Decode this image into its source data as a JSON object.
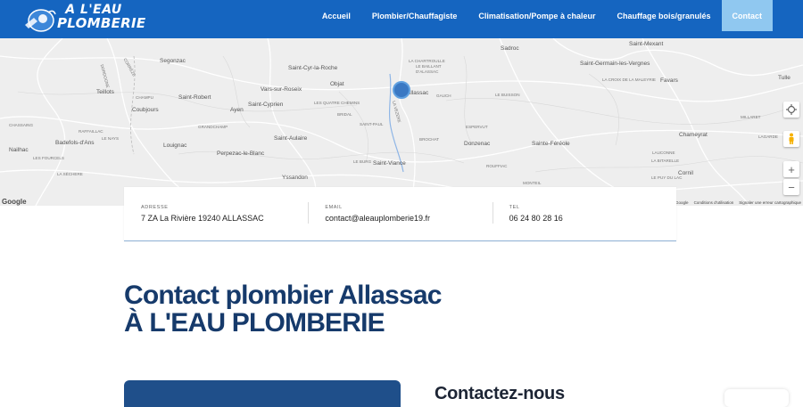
{
  "header": {
    "logo_line1": "A L'EAU",
    "logo_line2": "PLOMBERIE",
    "nav": [
      {
        "label": "Accueil"
      },
      {
        "label": "Plombier/Chauffagiste"
      },
      {
        "label": "Climatisation/Pompe à chaleur"
      },
      {
        "label": "Chauffage bois/granulés"
      },
      {
        "label": "Contact"
      }
    ],
    "accent": "#1565c0",
    "active_bg": "#90c8f0"
  },
  "map": {
    "places": [
      "Segonzac",
      "Saint-Cyr-la-Roche",
      "Sadroc",
      "Saint-Mexant",
      "Saint-Germain-les-Vergnes",
      "Teillots",
      "Saint-Robert",
      "Vars-sur-Roseix",
      "Objat",
      "Allassac",
      "Tulle",
      "Favars",
      "Coubjours",
      "Ayen",
      "Saint-Cyprien",
      "Chameyrat",
      "Badefols-d'Ans",
      "Saint-Aulaire",
      "Donzenac",
      "Sainte-Féréole",
      "Nailhac",
      "Louignac",
      "Perpezac-le-Blanc",
      "Saint-Viance",
      "Cornil",
      "Yssandon"
    ],
    "small_places": [
      "CORRÈZE",
      "DORDOGNE",
      "LA CHARTROULLE",
      "LE BAILLANT",
      "D'ALASSAC",
      "CHAMPU",
      "LE BUISSON",
      "LA CROIX DE LA MALEYRIE",
      "GAUCH",
      "LES QUATRE CHEMINS",
      "BRIDAL",
      "LA VEZERE",
      "CHASSAING",
      "GRANDCHAMP",
      "SAINT-PAUL",
      "ESPERVUT",
      "RAFFAILLAC",
      "LE NAYS",
      "LES FOURCELS",
      "BROCHAT",
      "LAUCONNE",
      "LA SÈCHERE",
      "LE BURG",
      "ROUFFIAC",
      "LE PUY DU LAC",
      "MILLARET",
      "LA BITARELLE",
      "MONTEIL",
      "LAGARDE"
    ],
    "zoom_in": "+",
    "zoom_out": "−",
    "google_label": "Google",
    "footer_links": [
      "Raccourcis clavier",
      "Données cartographiques ©2024 Google",
      "Conditions d'utilisation",
      "Signaler une erreur cartographique"
    ]
  },
  "contact_info": {
    "address_label": "ADRESSE",
    "address": "7 ZA La Rivière 19240 ALLASSAC",
    "email_label": "EMAIL",
    "email": "contact@aleauplomberie19.fr",
    "tel_label": "TEL",
    "tel": "06 24 80 28 16"
  },
  "page": {
    "title_line1": "Contact plombier Allassac",
    "title_line2": "À L'EAU PLOMBERIE",
    "contact_heading": "Contactez-nous",
    "title_color": "#163a6b"
  }
}
